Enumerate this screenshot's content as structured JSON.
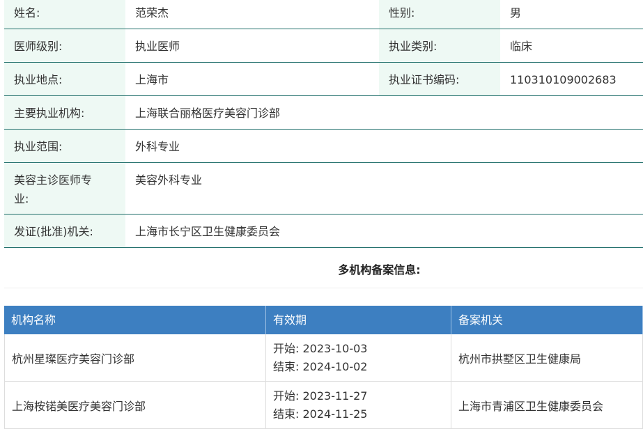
{
  "info": {
    "rows": [
      {
        "label1": "姓名:",
        "value1": "范荣杰",
        "label2": "性别:",
        "value2": "男"
      },
      {
        "label1": "医师级别:",
        "value1": "执业医师",
        "label2": "执业类别:",
        "value2": "临床"
      },
      {
        "label1": "执业地点:",
        "value1": "上海市",
        "label2": "执业证书编码:",
        "value2": "110310109002683"
      }
    ],
    "institution_label": "主要执业机构:",
    "institution_value": "上海联合丽格医疗美容门诊部",
    "scope_label": "执业范围:",
    "scope_value": "外科专业",
    "specialty_label": "美容主诊医师专业:",
    "specialty_value": "美容外科专业",
    "issuer_label": "发证(批准)机关:",
    "issuer_value": "上海市长宁区卫生健康委员会"
  },
  "section_title": "多机构备案信息:",
  "records": {
    "headers": [
      "机构名称",
      "有效期",
      "备案机关"
    ],
    "rows": [
      {
        "name": "杭州星璨医疗美容门诊部",
        "start": "开始:  2023-10-03",
        "end": "结束:  2024-10-02",
        "authority": "杭州市拱墅区卫生健康局"
      },
      {
        "name": "上海桉锘美医疗美容门诊部",
        "start": "开始:  2023-11-27",
        "end": "结束:  2024-11-25",
        "authority": "上海市青浦区卫生健康委员会"
      }
    ]
  }
}
